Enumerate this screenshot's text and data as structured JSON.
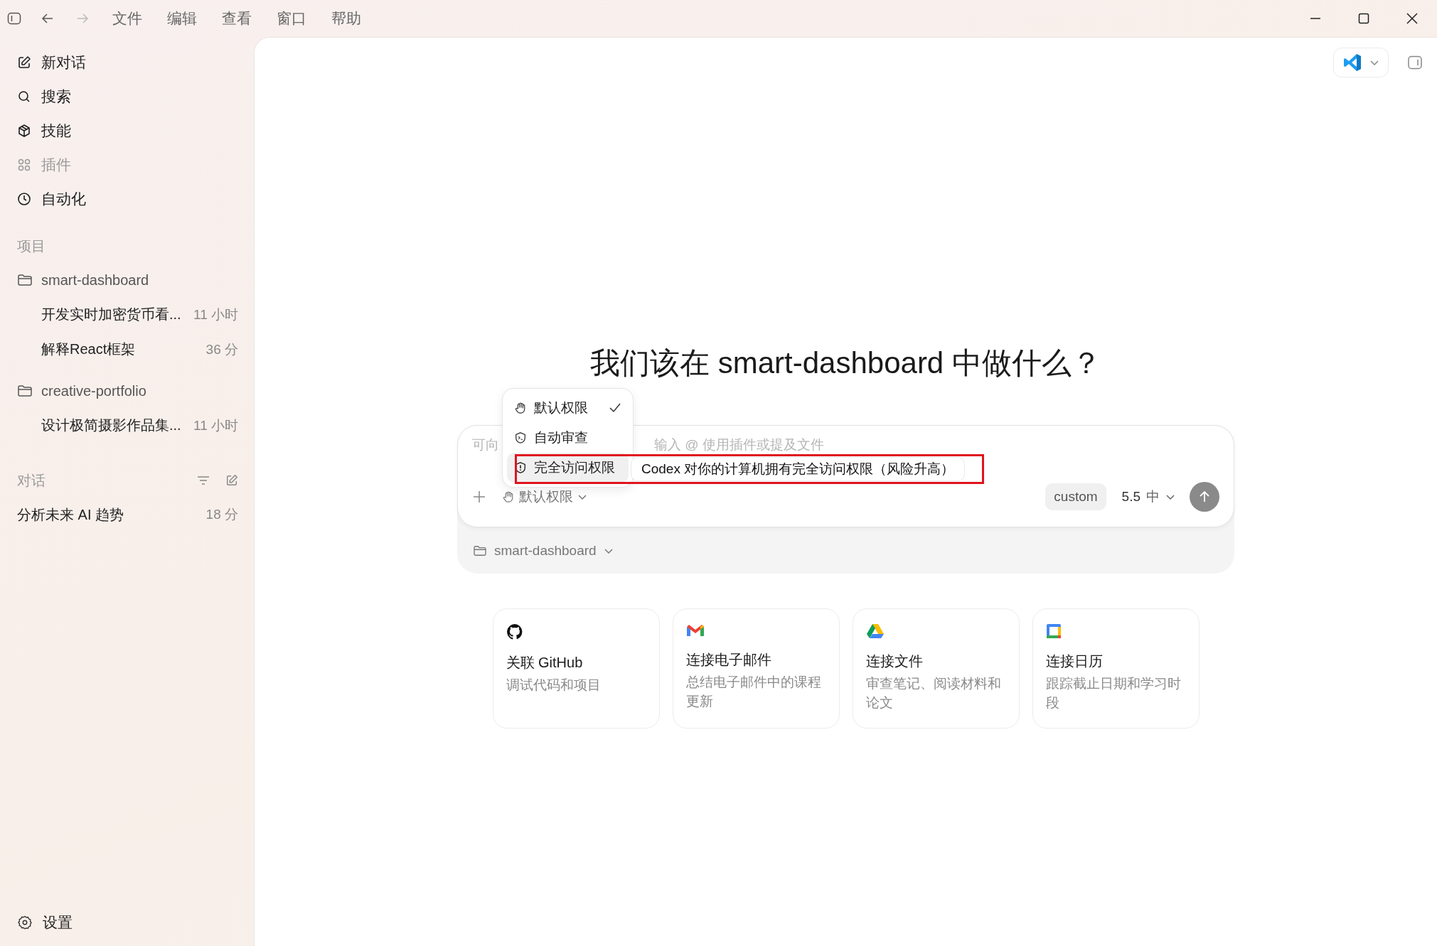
{
  "window": {
    "menu": [
      "文件",
      "编辑",
      "查看",
      "窗口",
      "帮助"
    ]
  },
  "sidebar": {
    "nav": [
      {
        "label": "新对话",
        "disabled": false
      },
      {
        "label": "搜索",
        "disabled": false
      },
      {
        "label": "技能",
        "disabled": false
      },
      {
        "label": "插件",
        "disabled": true
      },
      {
        "label": "自动化",
        "disabled": false
      }
    ],
    "projects_heading": "项目",
    "projects": [
      {
        "name": "smart-dashboard",
        "children": [
          {
            "title": "开发实时加密货币看...",
            "time": "11 小时"
          },
          {
            "title": "解释React框架",
            "time": "36 分"
          }
        ]
      },
      {
        "name": "creative-portfolio",
        "children": [
          {
            "title": "设计极简摄影作品集...",
            "time": "11 小时"
          }
        ]
      }
    ],
    "conversations_heading": "对话",
    "conversations": [
      {
        "title": "分析未来 AI 趋势",
        "time": "18 分"
      }
    ],
    "settings": "设置"
  },
  "main": {
    "heading": "我们该在 smart-dashboard 中做什么？",
    "composer": {
      "placeholder_parts": [
        "可向",
        "输入 @ 使用插件或提及文件"
      ],
      "permission": "默认权限",
      "chip": "custom",
      "model": "5.5",
      "effort": "中",
      "folder": "smart-dashboard"
    },
    "permission_menu": [
      {
        "label": "默认权限",
        "selected": true,
        "highlighted": false
      },
      {
        "label": "自动审查",
        "selected": false,
        "highlighted": false
      },
      {
        "label": "完全访问权限",
        "selected": false,
        "highlighted": true
      }
    ],
    "tooltip": "Codex 对你的计算机拥有完全访问权限（风险升高）",
    "suggestions": [
      {
        "title": "关联 GitHub",
        "subtitle": "调试代码和项目"
      },
      {
        "title": "连接电子邮件",
        "subtitle": "总结电子邮件中的课程更新"
      },
      {
        "title": "连接文件",
        "subtitle": "审查笔记、阅读材料和论文"
      },
      {
        "title": "连接日历",
        "subtitle": "跟踪截止日期和学习时段"
      }
    ]
  }
}
